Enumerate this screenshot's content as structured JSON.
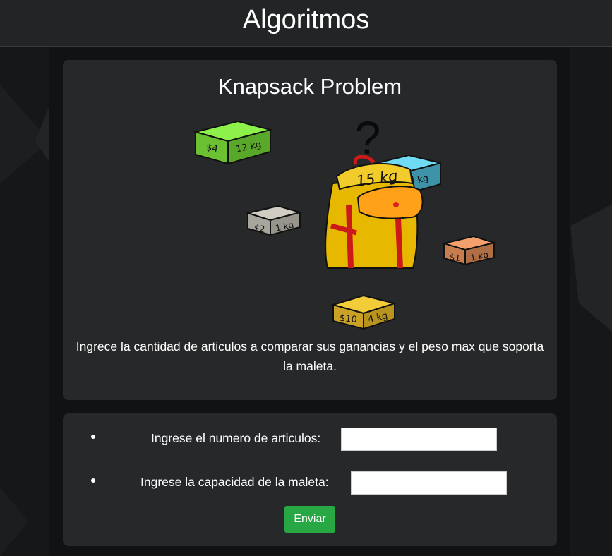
{
  "header": {
    "title": "Algoritmos"
  },
  "intro": {
    "title": "Knapsack Problem",
    "description": "Ingrece la cantidad de articulos a comparar sus ganancias y el peso max que soporta la maleta.",
    "illustration": {
      "question_mark": "?",
      "bag_capacity": "15 kg",
      "items": [
        {
          "price": "$4",
          "weight": "12 kg",
          "color": "#73e02e"
        },
        {
          "price": "$2",
          "weight": "2 kg",
          "color": "#57c7de"
        },
        {
          "price": "$2",
          "weight": "1 kg",
          "color": "#b5b2a8"
        },
        {
          "price": "$1",
          "weight": "1 kg",
          "color": "#e88d57"
        },
        {
          "price": "$10",
          "weight": "4 kg",
          "color": "#e0b828"
        }
      ]
    }
  },
  "form": {
    "num_items_label": "Ingrese el numero de articulos:",
    "num_items_value": "",
    "capacity_label": "Ingrese la capacidad de la maleta:",
    "capacity_value": "",
    "submit_label": "Enviar"
  }
}
